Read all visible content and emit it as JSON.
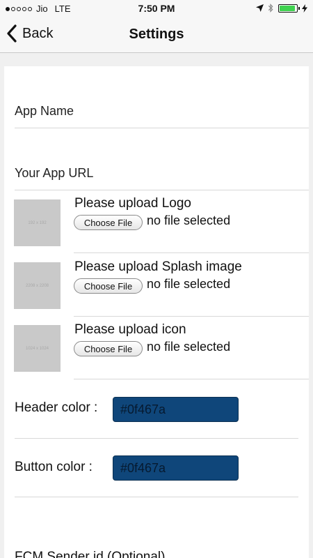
{
  "status_bar": {
    "carrier": "Jio",
    "network": "LTE",
    "time": "7:50 PM",
    "battery_level": 0.9,
    "battery_color": "#3fd24f"
  },
  "nav": {
    "back_label": "Back",
    "title": "Settings"
  },
  "form": {
    "app_name_label": "App Name",
    "app_url_label": "Your App URL",
    "uploads": [
      {
        "title": "Please upload Logo",
        "button": "Choose File",
        "status": "no file selected",
        "thumb_text": "192 x 192"
      },
      {
        "title": "Please upload Splash image",
        "button": "Choose File",
        "status": "no file selected",
        "thumb_text": "2208 x 2208"
      },
      {
        "title": "Please upload icon",
        "button": "Choose File",
        "status": "no file selected",
        "thumb_text": "1024 x 1024"
      }
    ],
    "header_color_label": "Header color :",
    "header_color_value": "#0f467a",
    "button_color_label": "Button color :",
    "button_color_value": "#0f467a",
    "fcm_label": "FCM Sender id (Optional)"
  }
}
